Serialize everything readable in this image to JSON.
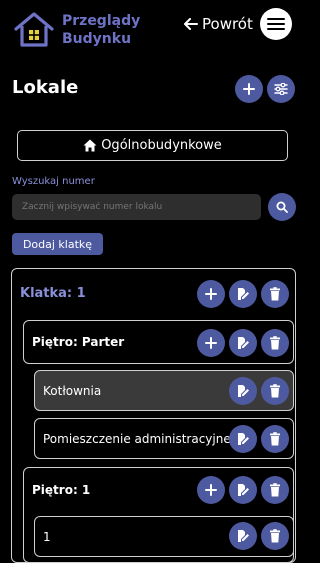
{
  "header": {
    "logo_line1": "Przeglądy",
    "logo_line2": "Budynku",
    "back_label": "Powrót",
    "back_arrow": "arrow-left-icon",
    "menu_icon": "hamburger-icon"
  },
  "page": {
    "title": "Lokale",
    "add_icon": "plus-icon",
    "filter_icon": "sliders-icon"
  },
  "general_button": {
    "label": "Ogólnobudynkowe",
    "icon": "home-icon"
  },
  "search": {
    "label": "Wyszukaj numer",
    "placeholder": "Zacznij wpisywać numer lokalu",
    "icon": "search-icon"
  },
  "add_staircase_label": "Dodaj klatkę",
  "tree": [
    {
      "label": "Klatka: 1",
      "level": 0,
      "actions": [
        "plus-icon",
        "edit-icon",
        "trash-icon"
      ],
      "active": false
    },
    {
      "label": "Piętro: Parter",
      "level": 1,
      "actions": [
        "plus-icon",
        "edit-icon",
        "trash-icon"
      ],
      "active": false
    },
    {
      "label": "Kotłownia",
      "level": 2,
      "actions": [
        "edit-icon",
        "trash-icon"
      ],
      "active": true
    },
    {
      "label": "Pomieszczenie administracyjne",
      "level": 2,
      "actions": [
        "edit-icon",
        "trash-icon"
      ],
      "active": false
    },
    {
      "label": "Piętro: 1",
      "level": 1,
      "actions": [
        "plus-icon",
        "edit-icon",
        "trash-icon"
      ],
      "active": false
    },
    {
      "label": "1",
      "level": 2,
      "actions": [
        "edit-icon",
        "trash-icon"
      ],
      "active": false
    }
  ],
  "colors": {
    "accent": "#4e5aa0",
    "logo_text": "#6e73c6",
    "staircase_label": "#8a90d8",
    "search_label": "#8a90d8",
    "input_bg": "#2e2e2e"
  }
}
